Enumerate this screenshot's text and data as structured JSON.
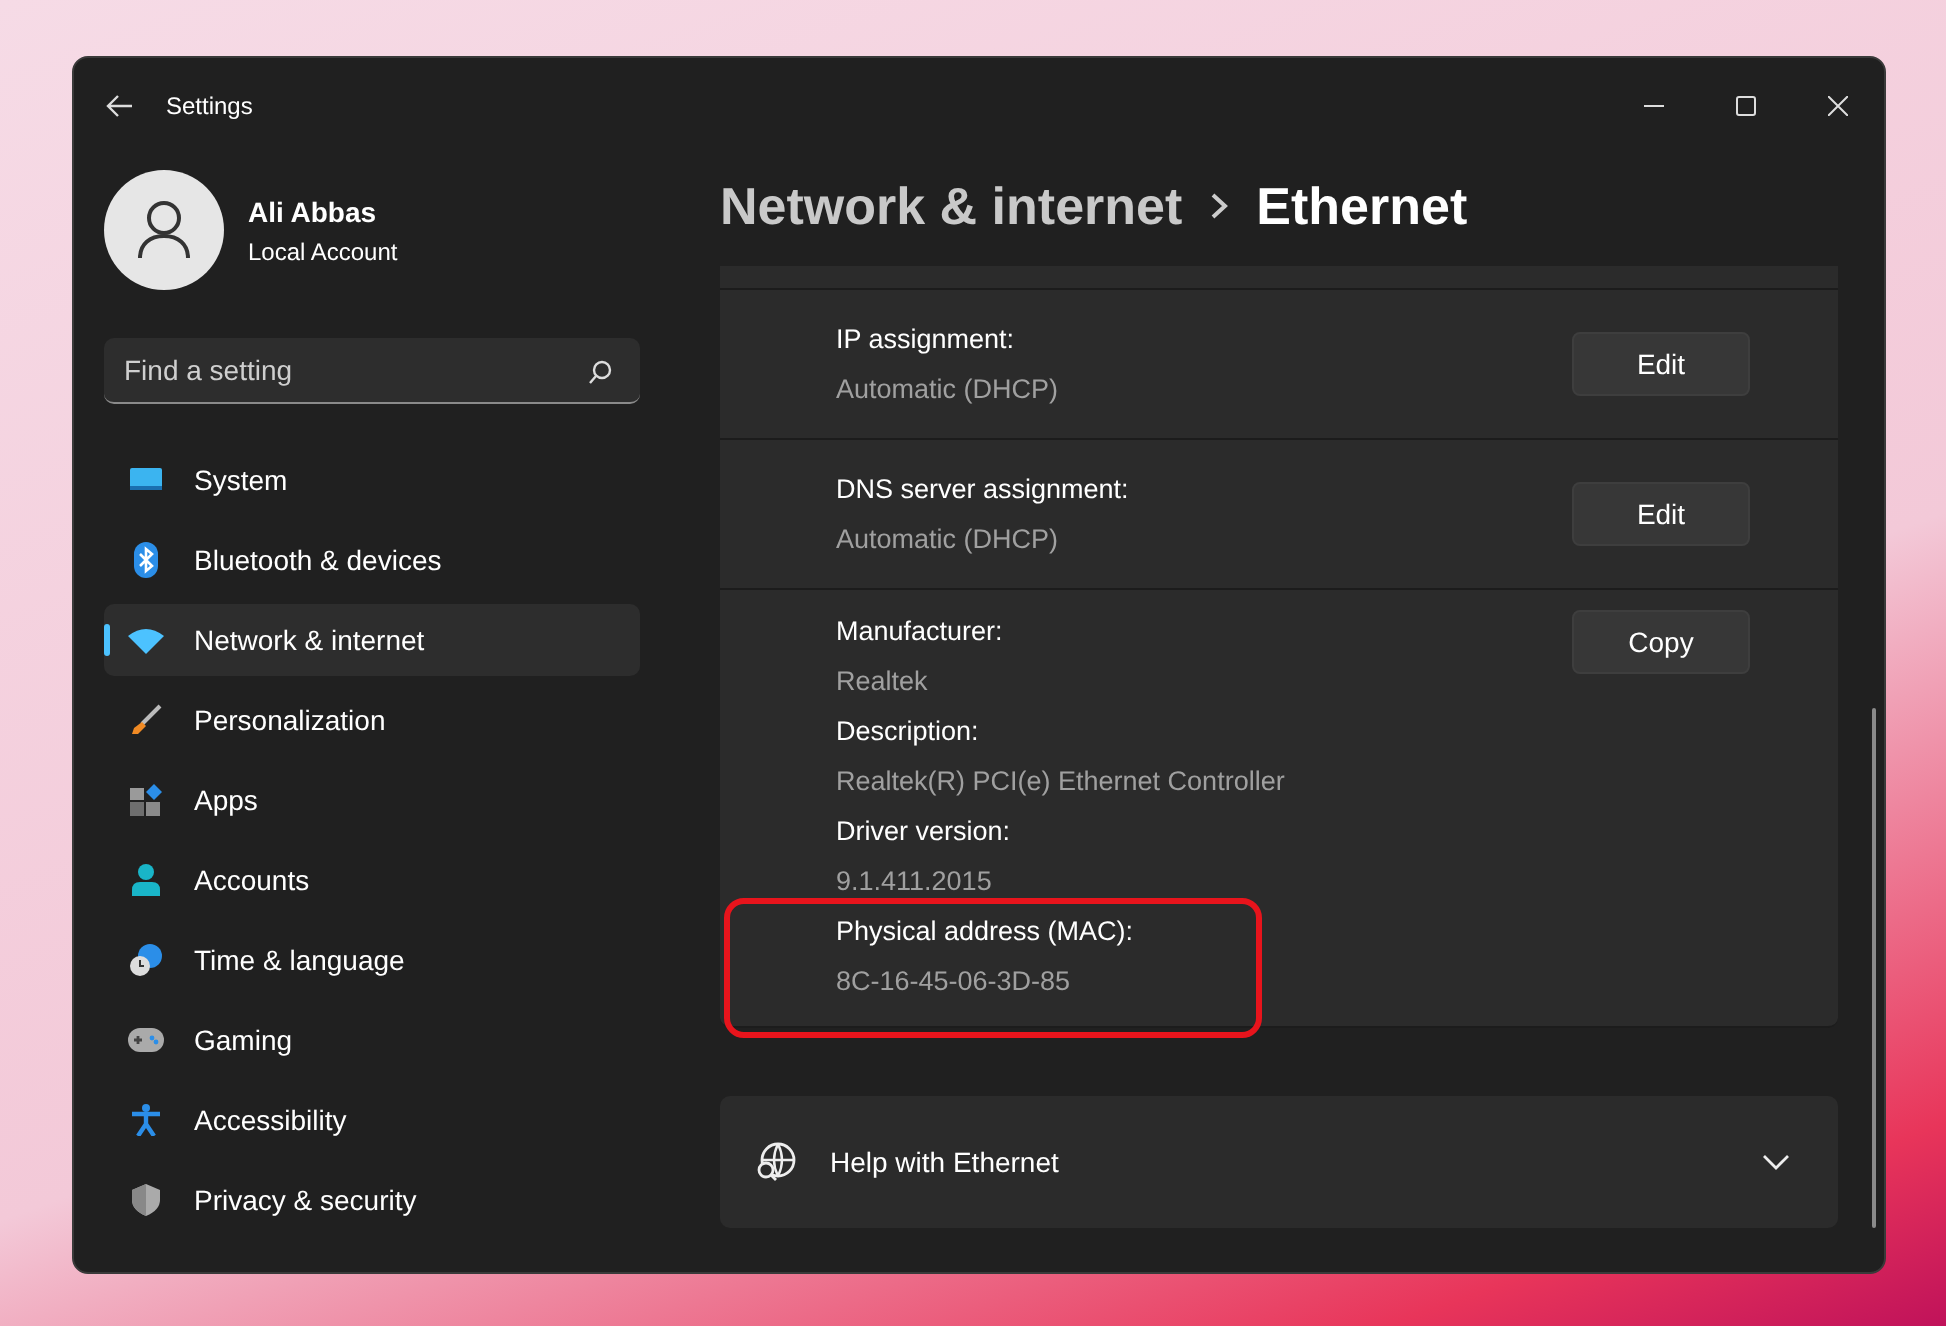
{
  "window": {
    "title": "Settings"
  },
  "user": {
    "name": "Ali Abbas",
    "account": "Local Account"
  },
  "search": {
    "placeholder": "Find a setting"
  },
  "nav": [
    {
      "label": "System",
      "kind": "system",
      "selected": false
    },
    {
      "label": "Bluetooth & devices",
      "kind": "bluetooth",
      "selected": false
    },
    {
      "label": "Network & internet",
      "kind": "network",
      "selected": true
    },
    {
      "label": "Personalization",
      "kind": "brush",
      "selected": false
    },
    {
      "label": "Apps",
      "kind": "apps",
      "selected": false
    },
    {
      "label": "Accounts",
      "kind": "accounts",
      "selected": false
    },
    {
      "label": "Time & language",
      "kind": "time",
      "selected": false
    },
    {
      "label": "Gaming",
      "kind": "gaming",
      "selected": false
    },
    {
      "label": "Accessibility",
      "kind": "accessibility",
      "selected": false
    },
    {
      "label": "Privacy & security",
      "kind": "privacy",
      "selected": false
    }
  ],
  "breadcrumb": {
    "parent": "Network & internet",
    "current": "Ethernet"
  },
  "settings": [
    {
      "label": "IP assignment:",
      "value": "Automatic (DHCP)",
      "button": "Edit"
    },
    {
      "label": "DNS server assignment:",
      "value": "Automatic (DHCP)",
      "button": "Edit"
    }
  ],
  "details": {
    "button": "Copy",
    "items": [
      {
        "label": "Manufacturer:",
        "value": "Realtek",
        "highlighted": false
      },
      {
        "label": "Description:",
        "value": "Realtek(R) PCI(e) Ethernet Controller",
        "highlighted": false
      },
      {
        "label": "Driver version:",
        "value": "9.1.411.2015",
        "highlighted": false
      },
      {
        "label": "Physical address (MAC):",
        "value": "8C-16-45-06-3D-85",
        "highlighted": true
      }
    ]
  },
  "help": {
    "label": "Help with Ethernet",
    "expanded": false
  }
}
